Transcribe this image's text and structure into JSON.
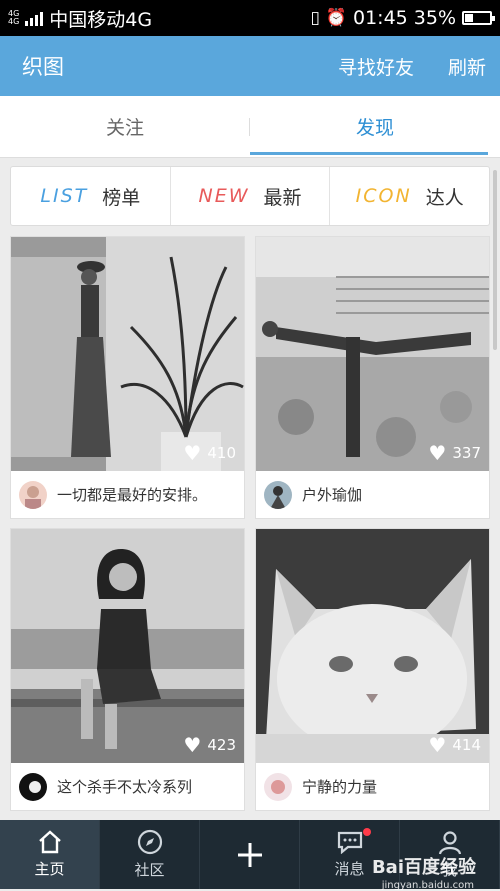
{
  "status": {
    "carrier": "中国移动4G",
    "time": "01:45",
    "battery": "35%",
    "battery_level": 0.35
  },
  "appbar": {
    "title": "织图",
    "find_friends": "寻找好友",
    "refresh": "刷新"
  },
  "tabs": [
    {
      "label": "关注",
      "active": false
    },
    {
      "label": "发现",
      "active": true
    }
  ],
  "categories": [
    {
      "tag": "LIST",
      "label": "榜单",
      "color": "#4aa0e0"
    },
    {
      "tag": "NEW",
      "label": "最新",
      "color": "#e85a5a"
    },
    {
      "tag": "ICON",
      "label": "达人",
      "color": "#f2b431"
    }
  ],
  "posts": [
    {
      "likes": "410",
      "author": "一切都是最好的安排。",
      "image": "woman-by-window-with-plant"
    },
    {
      "likes": "337",
      "author": "户外瑜伽",
      "image": "yoga-pose-outdoors"
    },
    {
      "likes": "423",
      "author": "这个杀手不太冷系列",
      "image": "girl-sitting-on-ledge"
    },
    {
      "likes": "414",
      "author": "宁静的力量",
      "image": "white-cat"
    }
  ],
  "bottom_nav": [
    {
      "label": "主页",
      "icon": "home-icon",
      "active": true
    },
    {
      "label": "社区",
      "icon": "compass-icon",
      "active": false
    },
    {
      "label": "",
      "icon": "plus-icon",
      "active": false
    },
    {
      "label": "消息",
      "icon": "message-icon",
      "active": false
    },
    {
      "label": "我",
      "icon": "user-icon",
      "active": false
    }
  ],
  "watermark": {
    "text": "Bai百度经验",
    "url": "jingyan.baidu.com"
  }
}
